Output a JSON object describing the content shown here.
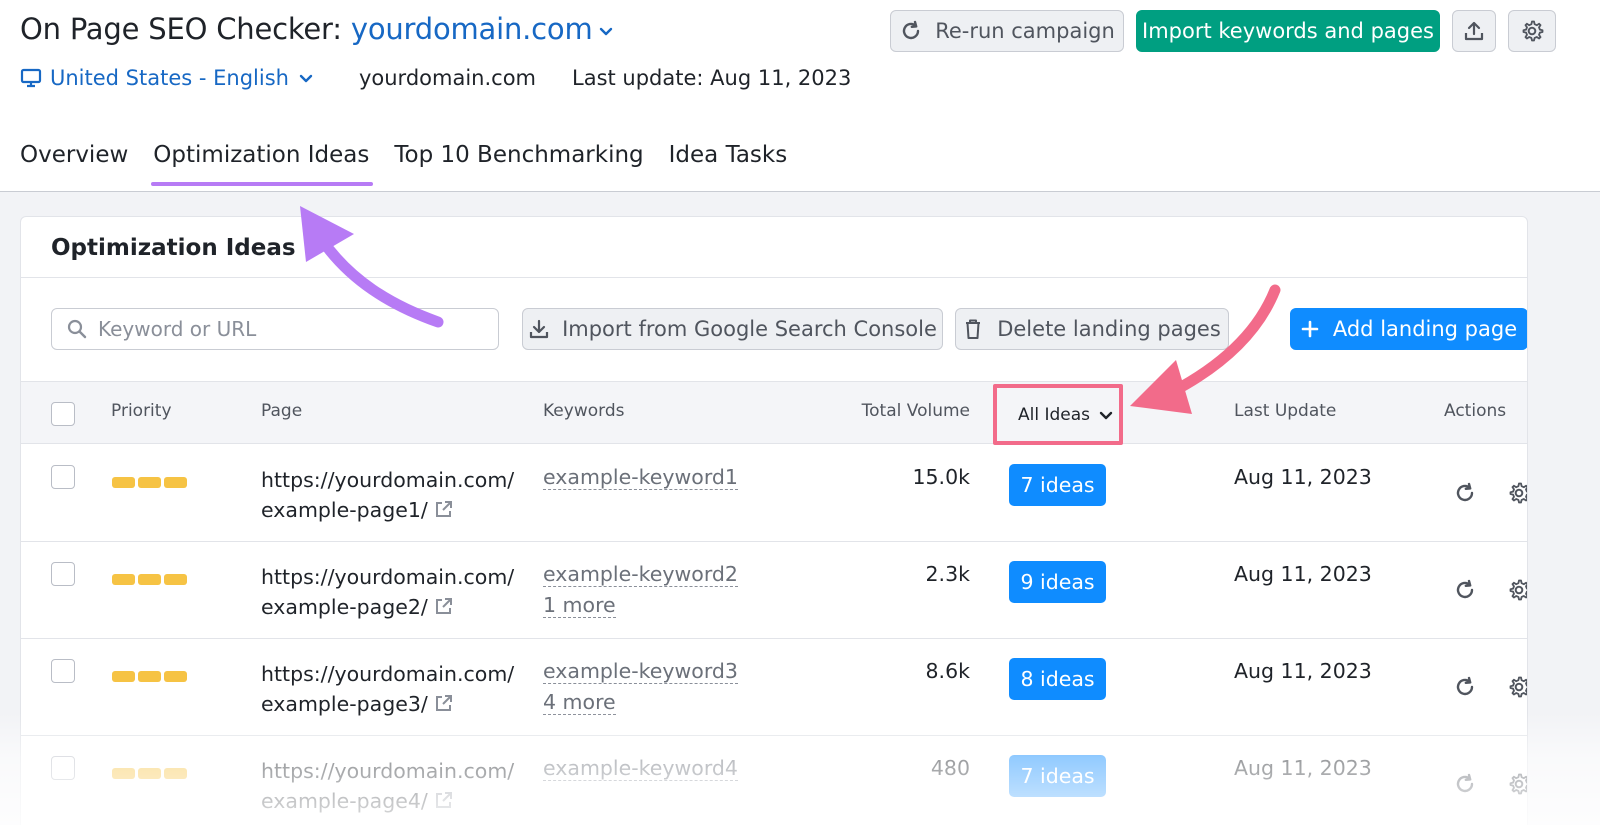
{
  "header": {
    "title_prefix": "On Page SEO Checker:",
    "domain": "yourdomain.com",
    "location": "United States - English",
    "project_domain": "yourdomain.com",
    "last_update": "Last update: Aug 11, 2023",
    "rerun_label": "Re-run campaign",
    "import_label": "Import keywords and pages"
  },
  "tabs": [
    {
      "label": "Overview"
    },
    {
      "label": "Optimization Ideas"
    },
    {
      "label": "Top 10 Benchmarking"
    },
    {
      "label": "Idea Tasks"
    }
  ],
  "card": {
    "title": "Optimization Ideas",
    "search_placeholder": "Keyword or URL",
    "import_gsc_label": "Import from Google Search Console",
    "delete_label": "Delete landing pages",
    "add_label": "Add landing page"
  },
  "table": {
    "headers": {
      "priority": "Priority",
      "page": "Page",
      "keywords": "Keywords",
      "volume": "Total Volume",
      "ideas_filter": "All Ideas",
      "last_update": "Last Update",
      "actions": "Actions"
    },
    "rows": [
      {
        "url_line1": "https://yourdomain.com/",
        "url_line2": "example-page1/",
        "keyword": "example-keyword1",
        "more": "",
        "volume": "15.0k",
        "ideas": "7 ideas",
        "date": "Aug 11, 2023"
      },
      {
        "url_line1": "https://yourdomain.com/",
        "url_line2": "example-page2/",
        "keyword": "example-keyword2",
        "more": "1 more",
        "volume": "2.3k",
        "ideas": "9 ideas",
        "date": "Aug 11, 2023"
      },
      {
        "url_line1": "https://yourdomain.com/",
        "url_line2": "example-page3/",
        "keyword": "example-keyword3",
        "more": "4 more",
        "volume": "8.6k",
        "ideas": "8 ideas",
        "date": "Aug 11, 2023"
      },
      {
        "url_line1": "https://yourdomain.com/",
        "url_line2": "example-page4/",
        "keyword": "example-keyword4",
        "more": "",
        "volume": "480",
        "ideas": "7 ideas",
        "date": "Aug 11, 2023"
      }
    ]
  },
  "colors": {
    "brand_blue": "#1768c4",
    "button_blue": "#0f8cff",
    "green": "#009f81",
    "tab_underline": "#b77bf5",
    "priority_yellow": "#f6c344",
    "annotation_pink": "#f26b8a",
    "annotation_purple": "#b77bf5"
  }
}
